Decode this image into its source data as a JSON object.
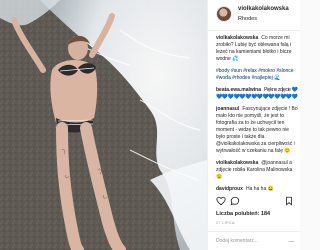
{
  "post": {
    "username": "violkakolakowska",
    "location": "Rhodes"
  },
  "comments": [
    {
      "user": "violkakolakowska",
      "text": "Co morze mi zrobiło? Lubię być oblewana falą i leżeć na kamieniami błotko i bicze wodne 💦"
    },
    {
      "user": "",
      "text": "#body #sun #relax #mokro #slonce #woda #rhodes #najlepiej 🌊"
    },
    {
      "user": "beata.ewa.malwina",
      "text": "Piękne zdjęcie 💙💙💙💙💙💙💙💙💙💙💙💙💙💙💙"
    },
    {
      "user": "joannasul",
      "text": "Fascynujące zdjęcie ! Bo mało kto nie pomyśli, że jest to fotografia za to że uchwycił ten moment - widzę to tak pewno nie było proste i także dla @violkakolakowska za cierpliwość i wytrwałość w czekaniu na falę 😊"
    },
    {
      "user": "violkakolakowska",
      "text": "@joannasul a zdjęcie robiła Karolina Malinowska 😉"
    },
    {
      "user": "davidproux",
      "text": "Ha ha ha 😀"
    }
  ],
  "likes_label": "Liczba polubień:",
  "likes_count": "184",
  "date": "27 LIPCA",
  "add_comment_placeholder": "Dodaj komentarz...",
  "more_label": "..."
}
